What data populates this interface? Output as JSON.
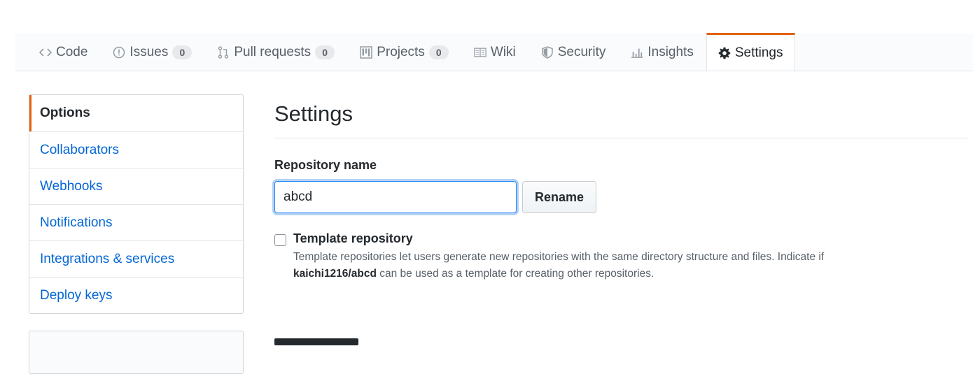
{
  "tabs": [
    {
      "label": "Code",
      "icon": "code-icon"
    },
    {
      "label": "Issues",
      "icon": "issue-opened-icon",
      "count": "0"
    },
    {
      "label": "Pull requests",
      "icon": "git-pull-request-icon",
      "count": "0"
    },
    {
      "label": "Projects",
      "icon": "project-icon",
      "count": "0"
    },
    {
      "label": "Wiki",
      "icon": "book-icon"
    },
    {
      "label": "Security",
      "icon": "shield-icon"
    },
    {
      "label": "Insights",
      "icon": "graph-icon"
    },
    {
      "label": "Settings",
      "icon": "gear-icon",
      "selected": true
    }
  ],
  "sidebar": {
    "items": [
      {
        "label": "Options",
        "active": true
      },
      {
        "label": "Collaborators"
      },
      {
        "label": "Webhooks"
      },
      {
        "label": "Notifications"
      },
      {
        "label": "Integrations & services"
      },
      {
        "label": "Deploy keys"
      }
    ]
  },
  "main": {
    "title": "Settings",
    "repo_name_label": "Repository name",
    "repo_name_value": "abcd",
    "rename_button": "Rename",
    "template_label": "Template repository",
    "template_note_pre": "Template repositories let users generate new repositories with the same directory structure and files. Indicate if",
    "template_note_repo": "kaichi1216/abcd",
    "template_note_post": "can be used as a template for creating other repositories."
  },
  "colors": {
    "accent": "#e36209",
    "link": "#0366d6",
    "focus": "#2188ff"
  }
}
